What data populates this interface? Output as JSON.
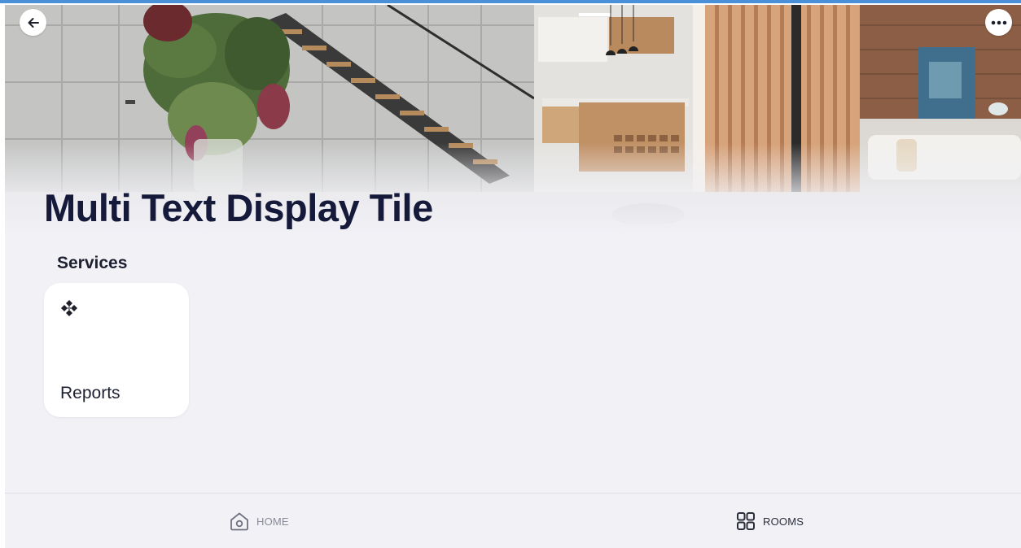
{
  "header": {
    "title": "Multi Text Display Tile",
    "back_icon": "arrow-left-icon",
    "more_icon": "more-horizontal-icon"
  },
  "services": {
    "section_title": "Services",
    "tiles": [
      {
        "label": "Reports",
        "icon": "diamond-cluster-icon"
      }
    ]
  },
  "bottom_nav": {
    "items": [
      {
        "label": "HOME",
        "icon": "home-icon",
        "active": false
      },
      {
        "label": "ROOMS",
        "icon": "grid-icon",
        "active": true
      }
    ]
  },
  "colors": {
    "accent_line": "#4a90d9",
    "background": "#f1f1f6",
    "title_text": "#161a3a",
    "tile_background": "#ffffff",
    "nav_inactive": "#888a96",
    "nav_active": "#2a2d3a"
  }
}
